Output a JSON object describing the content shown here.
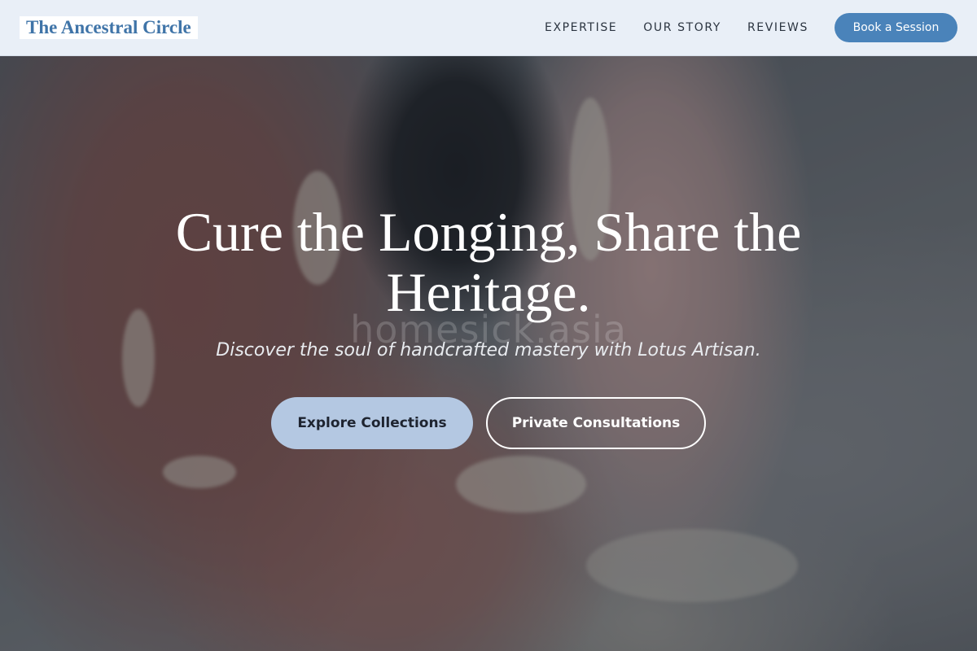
{
  "header": {
    "logo": "The Ancestral Circle",
    "nav": [
      {
        "label": "EXPERTISE"
      },
      {
        "label": "OUR STORY"
      },
      {
        "label": "REVIEWS"
      }
    ],
    "cta_label": "Book a Session"
  },
  "hero": {
    "title": "Cure the Longing, Share the Heritage.",
    "watermark": "homesick.asia",
    "subtitle": "Discover the soul of handcrafted mastery with Lotus Artisan.",
    "primary_button": "Explore Collections",
    "secondary_button": "Private Consultations",
    "background_description_icon": "hands-shaping-clay-image"
  },
  "colors": {
    "header_bg": "#e9eff7",
    "logo_text": "#3f74a8",
    "cta_bg": "#4a83ba",
    "primary_button_bg": "#b4c8e2"
  }
}
